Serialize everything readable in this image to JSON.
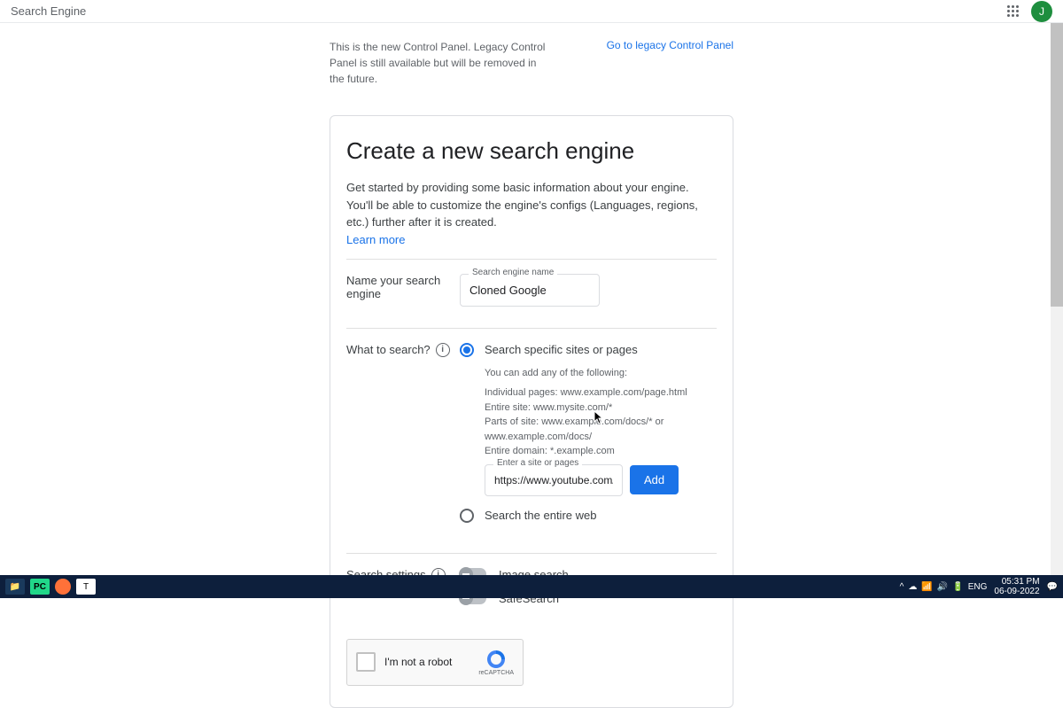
{
  "header": {
    "title": "Search Engine",
    "avatar_letter": "J"
  },
  "notice": {
    "text": "This is the new Control Panel. Legacy Control Panel is still available but will be removed in the future.",
    "link": "Go to legacy Control Panel"
  },
  "card": {
    "title": "Create a new search engine",
    "description": "Get started by providing some basic information about your engine. You'll be able to customize the engine's configs (Languages, regions, etc.) further after it is created.",
    "learn_more": "Learn more"
  },
  "name_section": {
    "label": "Name your search engine",
    "field_label": "Search engine name",
    "value": "Cloned Google"
  },
  "search_section": {
    "label": "What to search?",
    "option_specific": "Search specific sites or pages",
    "option_entire": "Search the entire web",
    "hint_intro": "You can add any of the following:",
    "hint_examples": "Individual pages: www.example.com/page.html\nEntire site: www.mysite.com/*\nParts of site: www.example.com/docs/* or www.example.com/docs/\nEntire domain: *.example.com",
    "site_field_label": "Enter a site or pages",
    "site_value": "https://www.youtube.com/",
    "add_button": "Add"
  },
  "settings_section": {
    "label": "Search settings",
    "image_search": "Image search",
    "safe_search": "SafeSearch"
  },
  "recaptcha": {
    "text": "I'm not a robot",
    "brand": "reCAPTCHA"
  },
  "taskbar": {
    "lang": "ENG",
    "time": "05:31 PM",
    "date": "06-09-2022"
  }
}
